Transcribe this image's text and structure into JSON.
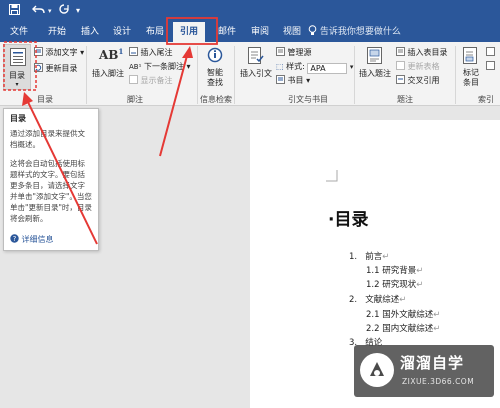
{
  "quick_access": {
    "save_icon": "save-icon",
    "undo_icon": "undo-icon",
    "redo_icon": "redo-icon",
    "customize_icon": "dropdown-icon"
  },
  "tabs": [
    {
      "label": "文件"
    },
    {
      "label": "开始"
    },
    {
      "label": "插入"
    },
    {
      "label": "设计"
    },
    {
      "label": "布局"
    },
    {
      "label": "引用",
      "active": true
    },
    {
      "label": "邮件"
    },
    {
      "label": "审阅"
    },
    {
      "label": "视图"
    }
  ],
  "tell_me": "告诉我你想要做什么",
  "ribbon": {
    "toc": {
      "big_label": "目录",
      "add_text": "添加文字",
      "update_toc": "更新目录",
      "group": "目录"
    },
    "footnotes": {
      "insert_footnote": "插入脚注",
      "insert_endnote": "插入尾注",
      "next_footnote": "下一条脚注",
      "show_notes": "显示备注",
      "group": "脚注"
    },
    "research": {
      "smart_lookup": "智能\n查找",
      "group": "信息检索"
    },
    "citations": {
      "insert_citation": "插入引文",
      "manage_sources": "管理源",
      "style_label": "样式:",
      "style_value": "APA",
      "bibliography": "书目",
      "group": "引文与书目"
    },
    "captions": {
      "insert_caption": "插入题注",
      "insert_table_of_figures": "插入表目录",
      "update_table": "更新表格",
      "cross_reference": "交叉引用",
      "group": "题注"
    },
    "index": {
      "mark_entry": "标记\n条目",
      "group": "索引"
    }
  },
  "tooltip": {
    "title": "目录",
    "desc1": "通过添加目录来提供文档概述。",
    "desc2": "这将会自动包括使用标题样式的文字。要包括更多条目，请选择文字并单击\"添加文字\"。当您单击\"更新目录\"时，目录将会刷新。",
    "more": "详细信息"
  },
  "document": {
    "heading": "·目录",
    "lines": [
      {
        "num": "1.",
        "text": "前言",
        "level": 1
      },
      {
        "num": "",
        "text": "1.1 研究背景",
        "level": 2
      },
      {
        "num": "",
        "text": "1.2 研究现状",
        "level": 2
      },
      {
        "num": "2.",
        "text": "文献综述",
        "level": 1
      },
      {
        "num": "",
        "text": "2.1 国外文献综述",
        "level": 2
      },
      {
        "num": "",
        "text": "2.2 国内文献综述",
        "level": 2
      },
      {
        "num": "3.",
        "text": "结论",
        "level": 1
      }
    ]
  },
  "watermark": {
    "title": "溜溜自学",
    "url": "ZIXUE.3D66.COM"
  },
  "colors": {
    "accent": "#2b579a",
    "highlight": "#e53935"
  }
}
